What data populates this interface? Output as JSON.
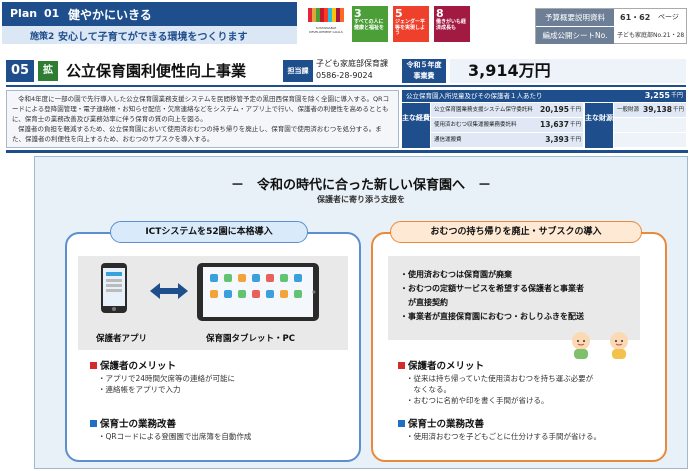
{
  "header": {
    "plan_label": "Plan",
    "plan_number": "01",
    "plan_title": "健やかにいきる",
    "policy_tag": "施策2",
    "policy_text": "安心して子育てができる環境をつくります",
    "sdg_logo_text": "SUSTAINABLE DEVELOPMENT GOALS",
    "sdgs": [
      {
        "num": "3",
        "label": "すべての人に健康と福祉を",
        "color": "#4c9f38"
      },
      {
        "num": "5",
        "label": "ジェンダー平等を実現しよう",
        "color": "#ef402b"
      },
      {
        "num": "8",
        "label": "働きがいも経済成長も",
        "color": "#a21942"
      }
    ],
    "meta": {
      "budget_doc_label": "予算概要説明資料",
      "budget_doc_pages": "61・62",
      "budget_doc_unit": "ページ",
      "sheet_label": "編成公開シートNo.",
      "sheet_value": "子ども家庭部No.21・28"
    }
  },
  "project": {
    "number": "05",
    "badge": "拡",
    "title": "公立保育園利便性向上事業",
    "dept_label": "担当課",
    "dept_name": "子ども家庭部保育課",
    "dept_phone": "0586-28-9024",
    "budget_label_1": "令和５年度",
    "budget_label_2": "事業費",
    "budget_value": "3,914万円"
  },
  "description": [
    "令和4年度に一部の園で先行導入した公立保育園業務支援システムを民間移管予定の黒田西保育園を除く全園に導入する。QRコードによる登降園管理・電子連絡帳・お知らせ配信・欠席連絡などをシステム・アプリ上で行い、保護者の利便性を高めるとともに、保育士の業務改善及び業務効率に伴う保育の質の向上を図る。",
    "保護者の負担を軽減するため、公立保育園において使用済おむつの持ち帰りを廃止し、保育園で使用済おむつを処分する。また、保護者の利便性を向上するため、おむつのサブスクを導入する。"
  ],
  "cost": {
    "header_label": "公立保育園入所児童及びその保護者１人あたり",
    "header_value": "3,255",
    "unit": "千円",
    "main_cost_label": "主な経費",
    "main_funding_label": "主な財源",
    "items": [
      {
        "label": "公立保育園業務支援システム保守委託料",
        "value": "20,195"
      },
      {
        "label": "使用済おむつ収集運搬業務委託料",
        "value": "13,637"
      },
      {
        "label": "通信運搬費",
        "value": "3,393"
      }
    ],
    "funding": [
      {
        "label": "一般財源",
        "value": "39,138"
      }
    ]
  },
  "main": {
    "heading": "－　令和の時代に合った新しい保育園へ　－",
    "subheading": "保護者に寄り添う支援を",
    "left": {
      "pill": "ICTシステムを52園に本格導入",
      "app_label": "保護者アプリ",
      "tablet_label": "保育園タブレット・PC",
      "merit1_title": "保護者のメリット",
      "merit1_items": [
        "・アプリで24時間欠席等の連絡が可能に",
        "・連絡帳をアプリで入力"
      ],
      "merit2_title": "保育士の業務改善",
      "merit2_items": [
        "・QRコードによる登園園で出席簿を自動作成"
      ]
    },
    "right": {
      "pill": "おむつの持ち帰りを廃止・サブスクの導入",
      "points": [
        "・使用済おむつは保育園が廃棄",
        "・おむつの定額サービスを希望する保護者と事業者",
        "　が直接契約",
        "・事業者が直接保育園におむつ・おしりふきを配送"
      ],
      "merit1_title": "保護者のメリット",
      "merit1_items": [
        "・従来は持ち帰っていた使用済おむつを持ち運ぶ必要が",
        "　なくなる。",
        "・おむつに名前や印を書く手間が省ける。"
      ],
      "merit2_title": "保育士の業務改善",
      "merit2_items": [
        "・使用済おむつを子どもごとに仕分けする手間が省ける。"
      ]
    }
  },
  "colors": {
    "navy": "#1f4e8c",
    "merit_red": "#d62a2a",
    "improve_blue": "#1f6fc5",
    "left_border": "#5b8fcf",
    "right_border": "#e98a3a"
  }
}
